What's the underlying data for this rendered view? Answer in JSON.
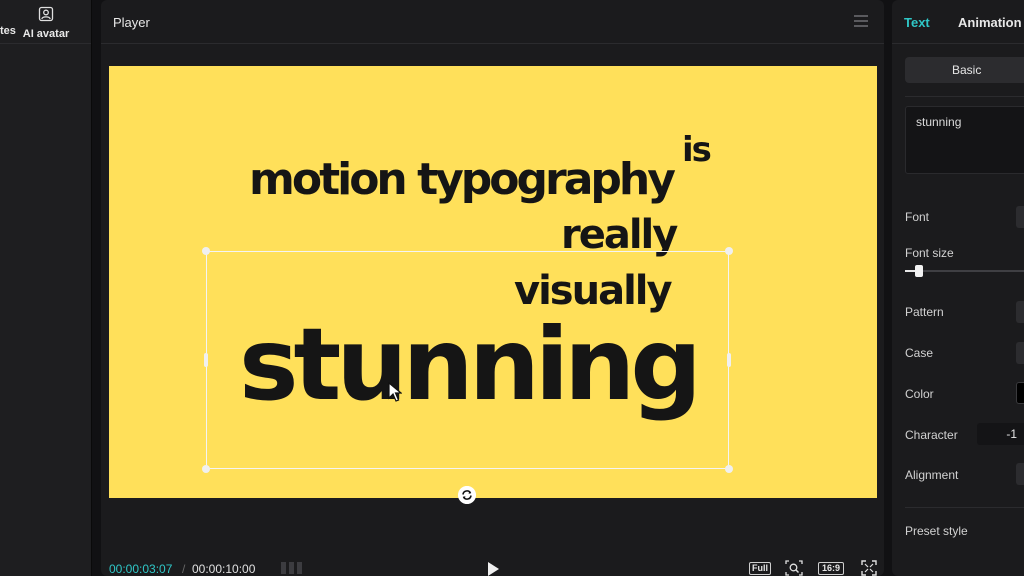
{
  "left_panel": {
    "tab_templates_label": "tes",
    "tab_avatar_label": "AI avatar"
  },
  "player": {
    "title": "Player",
    "canvas": {
      "background": "#ffe05a",
      "words": {
        "motion": "motion typography",
        "is": "is",
        "really": "really",
        "visually": "visually",
        "stunning": "stunning"
      }
    },
    "footer": {
      "current_time": "00:00:03:07",
      "separator": "/",
      "total_time": "00:00:10:00",
      "full_label": "Full",
      "ratio_label": "16:9"
    }
  },
  "right_panel": {
    "tabs": {
      "text": "Text",
      "animation": "Animation"
    },
    "segment_basic": "Basic",
    "text_value": "stunning",
    "labels": {
      "font": "Font",
      "font_size": "Font size",
      "pattern": "Pattern",
      "case": "Case",
      "color": "Color",
      "character": "Character",
      "alignment": "Alignment",
      "preset_style": "Preset style"
    },
    "character_value": "-1",
    "font_size_level": 0.1
  },
  "colors": {
    "accent": "#2fc7c7",
    "canvas_bg": "#ffe05a",
    "text_dark": "#151515"
  },
  "icons": [
    "avatar-icon",
    "menu-icon",
    "rotate-icon",
    "play-icon",
    "grid-icon",
    "zoom-icon",
    "fullscreen-icon",
    "cursor-icon"
  ]
}
